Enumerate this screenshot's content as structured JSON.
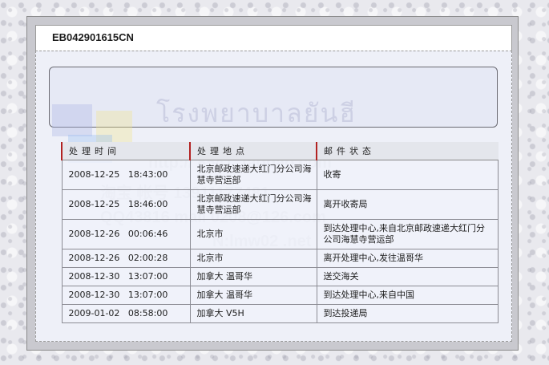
{
  "tracking_number": "EB042901615CN",
  "watermark": {
    "thai": "โรงพยาบาลยันฮี",
    "line1": "http://      8541      .taobao.com",
    "line2": "淘宝   帐号     13911177481",
    "line3": "QQ43816       mail   0208@126.com",
    "line4": "N:lmw02         .net"
  },
  "table": {
    "headers": [
      "处理时间",
      "处理地点",
      "邮件状态"
    ],
    "rows": [
      {
        "time": "2008-12-25   18:43:00",
        "place": "北京邮政速递大红门分公司海慧寺营运部",
        "status": "收寄",
        "tall": true
      },
      {
        "time": "2008-12-25   18:46:00",
        "place": "北京邮政速递大红门分公司海慧寺营运部",
        "status": "离开收寄局",
        "tall": true
      },
      {
        "time": "2008-12-26   00:06:46",
        "place": "北京市",
        "status": "到达处理中心,来自北京邮政速递大红门分公司海慧寺营运部",
        "tall": true
      },
      {
        "time": "2008-12-26   02:00:28",
        "place": "北京市",
        "status": "离开处理中心,发往温哥华",
        "tall": false
      },
      {
        "time": "2008-12-30   13:07:00",
        "place": "加拿大 温哥华",
        "status": "送交海关",
        "tall": false
      },
      {
        "time": "2008-12-30   13:07:00",
        "place": "加拿大 温哥华",
        "status": "到达处理中心,来自中国",
        "tall": false
      },
      {
        "time": "2009-01-02   08:58:00",
        "place": "加拿大 V5H",
        "status": "到达投递局",
        "tall": false
      }
    ]
  }
}
